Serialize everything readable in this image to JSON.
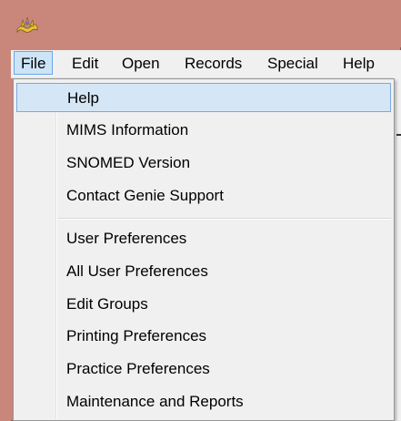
{
  "menubar": {
    "items": [
      {
        "label": "File"
      },
      {
        "label": "Edit"
      },
      {
        "label": "Open"
      },
      {
        "label": "Records"
      },
      {
        "label": "Special"
      },
      {
        "label": "Help"
      }
    ]
  },
  "file_menu": {
    "items": [
      {
        "label": "Help"
      },
      {
        "label": "MIMS Information"
      },
      {
        "label": "SNOMED Version"
      },
      {
        "label": "Contact Genie Support"
      },
      {
        "label": "User Preferences"
      },
      {
        "label": "All User Preferences"
      },
      {
        "label": "Edit Groups"
      },
      {
        "label": "Printing Preferences"
      },
      {
        "label": "Practice Preferences"
      },
      {
        "label": "Maintenance and Reports"
      }
    ]
  },
  "icons": {
    "app": "genie-app-icon"
  }
}
